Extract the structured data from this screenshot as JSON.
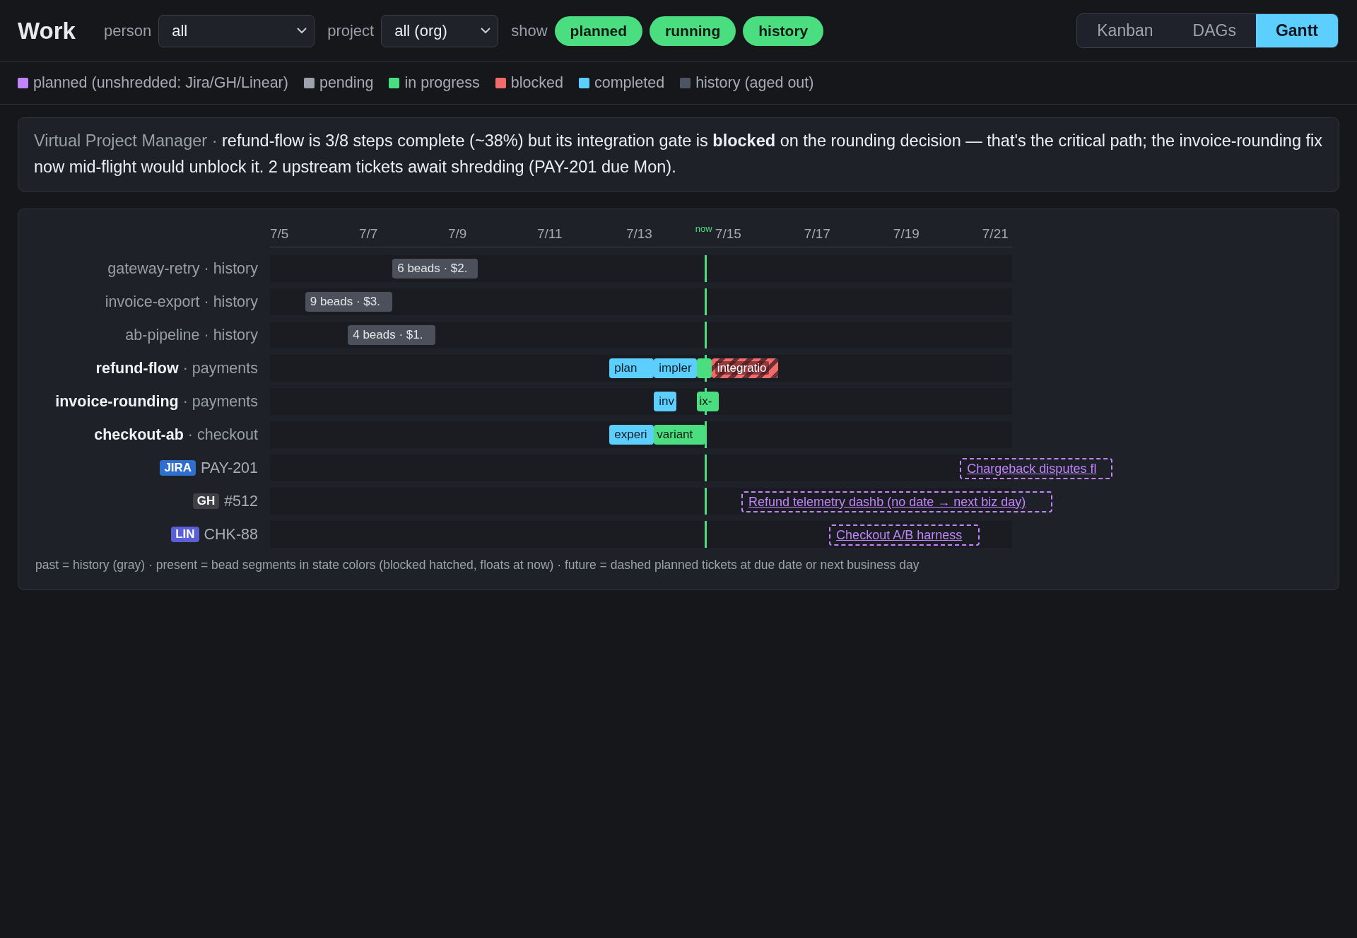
{
  "header": {
    "title": "Work",
    "filters": [
      {
        "label": "person",
        "value": "all"
      },
      {
        "label": "project",
        "value": "all (org)"
      }
    ],
    "show_label": "show",
    "toggles": [
      {
        "label": "planned",
        "selected": true
      },
      {
        "label": "running",
        "selected": true
      },
      {
        "label": "history",
        "selected": true
      }
    ],
    "views": [
      {
        "label": "Kanban",
        "selected": false
      },
      {
        "label": "DAGs",
        "selected": false
      },
      {
        "label": "Gantt",
        "selected": true
      }
    ]
  },
  "legend": [
    {
      "label": "planned (unshredded: Jira/GH/Linear)",
      "color": "#c084fc"
    },
    {
      "label": "pending",
      "color": "#9ca3af"
    },
    {
      "label": "in progress",
      "color": "#4ade80"
    },
    {
      "label": "blocked",
      "color": "#f26b6b"
    },
    {
      "label": "completed",
      "color": "#5ccfff"
    },
    {
      "label": "history (aged out)",
      "color": "#4b5563"
    }
  ],
  "summary": {
    "source": "Virtual Project Manager ·",
    "text": "refund-flow is 3/8 steps complete (~38%) but its integration gate is **blocked** on the rounding decision — that's the critical path; the invoice-rounding fix now mid-flight would unblock it. 2 upstream tickets await shredding (PAY-201 due Mon)."
  },
  "gantt": {
    "ticks": [
      "7/5",
      "7/7",
      "7/9",
      "7/11",
      "7/13",
      "7/15",
      "7/17",
      "7/19",
      "7/21"
    ],
    "now_label": "now",
    "rows": [
      {
        "kind": "history",
        "name": "gateway-retry",
        "group": "· history",
        "bars": [
          {
            "kind": "history",
            "label": "6 beads · $2."
          }
        ]
      },
      {
        "kind": "history",
        "name": "invoice-export",
        "group": "· history",
        "bars": [
          {
            "kind": "history",
            "label": "9 beads · $3."
          }
        ]
      },
      {
        "kind": "history",
        "name": "ab-pipeline",
        "group": "· history",
        "bars": [
          {
            "kind": "history",
            "label": "4 beads · $1."
          }
        ]
      },
      {
        "kind": "active",
        "name": "refund-flow",
        "group": "· payments",
        "bars": [
          {
            "kind": "completed",
            "label": "plan"
          },
          {
            "kind": "completed",
            "label": "impler"
          },
          {
            "kind": "in_progress"
          },
          {
            "kind": "blocked",
            "label": "integratio"
          }
        ]
      },
      {
        "kind": "active",
        "name": "invoice-rounding",
        "group": "· payments",
        "bars": [
          {
            "kind": "completed",
            "label": "inv"
          },
          {
            "kind": "in_progress",
            "label": "ix-"
          }
        ]
      },
      {
        "kind": "active",
        "name": "checkout-ab",
        "group": "· checkout",
        "bars": [
          {
            "kind": "completed",
            "label": "experi"
          },
          {
            "kind": "in_progress",
            "label": "variant"
          }
        ]
      },
      {
        "kind": "ticket",
        "source": {
          "label": "JIRA",
          "color": "#2f6fd0"
        },
        "name": "PAY-201",
        "bars": [
          {
            "kind": "planned",
            "label": "Chargeback disputes fl"
          }
        ]
      },
      {
        "kind": "ticket",
        "source": {
          "label": "GH",
          "color": "#3f4046"
        },
        "name": "#512",
        "bars": [
          {
            "kind": "planned",
            "label": "Refund telemetry dashb (no date → next biz day)"
          }
        ]
      },
      {
        "kind": "ticket",
        "source": {
          "label": "LIN",
          "color": "#5b5fd6"
        },
        "name": "CHK-88",
        "bars": [
          {
            "kind": "planned",
            "label": "Checkout A/B harness"
          }
        ]
      }
    ],
    "note": "past = history (gray) · present = bead segments in state colors (blocked hatched, floats at now) · future = dashed planned tickets at due date or next business day"
  }
}
